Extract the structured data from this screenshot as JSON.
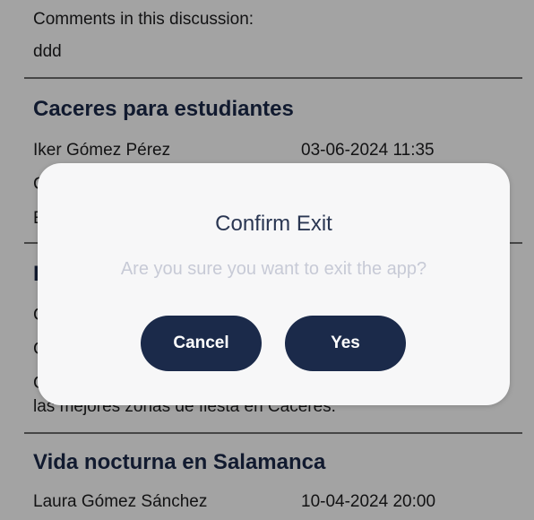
{
  "background": {
    "comments_header": "Comments in this discussion:",
    "comments_value": "ddd",
    "posts": [
      {
        "title": "Caceres para estudiantes",
        "author": "Iker Gómez Pérez",
        "date": "03-06-2024 11:35",
        "lines": [
          "C",
          "E"
        ]
      },
      {
        "title": "I",
        "lines": [
          "C",
          "C",
          "C",
          "las mejores zonas de fiesta en Caceres."
        ]
      },
      {
        "title": "Vida nocturna en Salamanca",
        "author": "Laura Gómez Sánchez",
        "date": "10-04-2024 20:00"
      }
    ]
  },
  "dialog": {
    "title": "Confirm Exit",
    "message": "Are you sure you want to exit the app?",
    "cancel_label": "Cancel",
    "confirm_label": "Yes"
  },
  "colors": {
    "primary": "#1b2a4a",
    "dialog_background": "#f7f7f8",
    "message_text": "#c7cad6"
  }
}
